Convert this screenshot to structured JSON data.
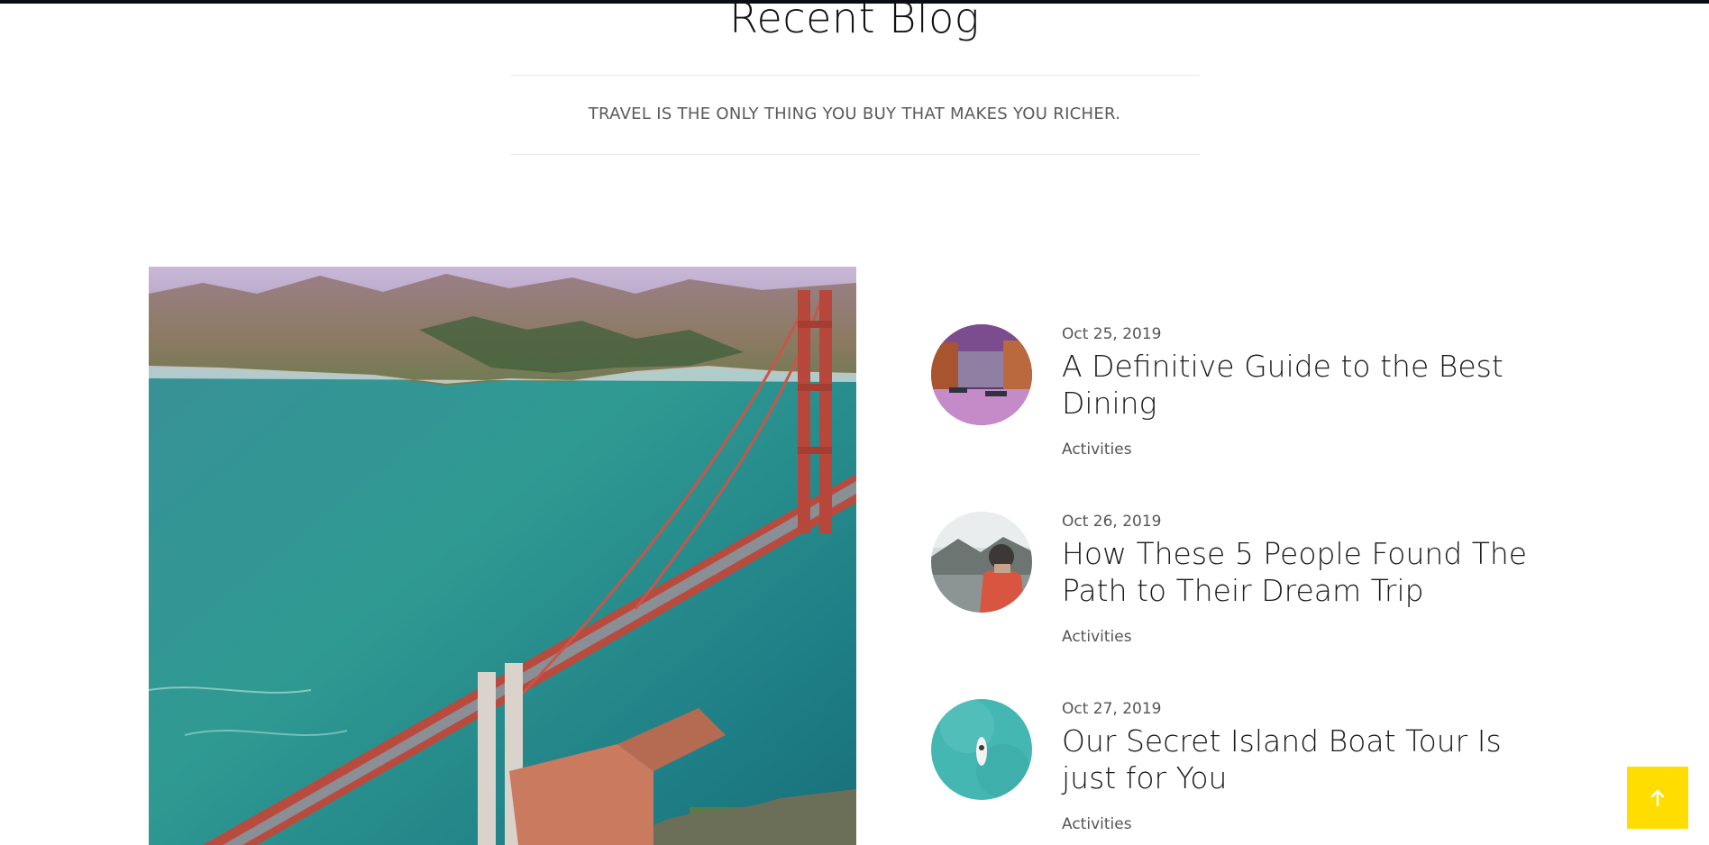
{
  "section": {
    "title": "Recent Blog",
    "tagline": "TRAVEL IS THE ONLY THING YOU BUY THAT MAKES YOU RICHER."
  },
  "posts": [
    {
      "date": "Oct 25, 2019",
      "title": "A Definitive Guide to the Best Dining",
      "category": "Activities",
      "thumb_icon": "venice-canal-thumbnail"
    },
    {
      "date": "Oct 26, 2019",
      "title": "How These 5 People Found The Path to Their Dream Trip",
      "category": "Activities",
      "thumb_icon": "traveler-lake-thumbnail"
    },
    {
      "date": "Oct 27, 2019",
      "title": "Our Secret Island Boat Tour Is just for You",
      "category": "Activities",
      "thumb_icon": "boat-sea-thumbnail"
    }
  ],
  "feature_image": {
    "icon": "golden-gate-bridge-photo"
  },
  "colors": {
    "accent": "#ffdd00",
    "text": "#1a1a1a",
    "muted": "#555555",
    "rule": "#e9e9e9"
  },
  "back_to_top": {
    "icon": "arrow-up-icon"
  }
}
